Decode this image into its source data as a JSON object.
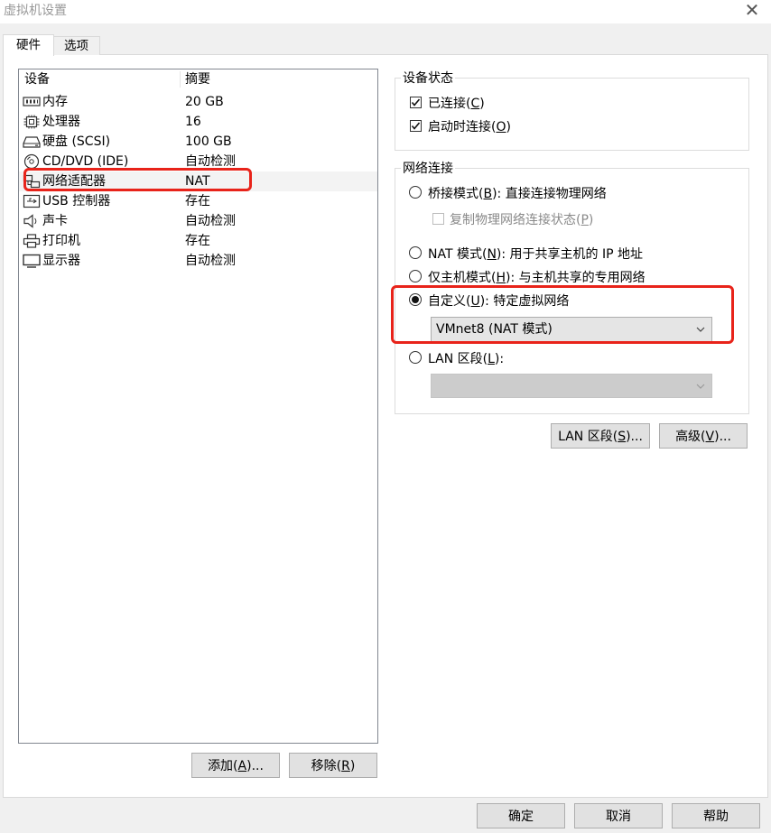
{
  "window": {
    "title": "虚拟机设置",
    "close_glyph": "✕"
  },
  "tabs": [
    {
      "label": "硬件",
      "active": true
    },
    {
      "label": "选项",
      "active": false
    }
  ],
  "device_list": {
    "headers": {
      "device": "设备",
      "summary": "摘要"
    },
    "rows": [
      {
        "icon": "memory-icon",
        "name": "内存",
        "summary": "20 GB"
      },
      {
        "icon": "processor-icon",
        "name": "处理器",
        "summary": "16"
      },
      {
        "icon": "hard-disk-icon",
        "name": "硬盘 (SCSI)",
        "summary": "100 GB"
      },
      {
        "icon": "cd-dvd-icon",
        "name": "CD/DVD (IDE)",
        "summary": "自动检测"
      },
      {
        "icon": "network-adapter-icon",
        "name": "网络适配器",
        "summary": "NAT",
        "selected": true
      },
      {
        "icon": "usb-controller-icon",
        "name": "USB 控制器",
        "summary": "存在"
      },
      {
        "icon": "sound-card-icon",
        "name": "声卡",
        "summary": "自动检测"
      },
      {
        "icon": "printer-icon",
        "name": "打印机",
        "summary": "存在"
      },
      {
        "icon": "display-icon",
        "name": "显示器",
        "summary": "自动检测"
      }
    ],
    "add": {
      "text": "添加(",
      "key": "A",
      "suffix": ")..."
    },
    "remove": {
      "text": "移除(",
      "key": "R",
      "suffix": ")"
    }
  },
  "device_status": {
    "legend": "设备状态",
    "connected": {
      "text": "已连接(",
      "key": "C",
      "suffix": ")",
      "checked": true
    },
    "connect_on_power_on": {
      "text": "启动时连接(",
      "key": "O",
      "suffix": ")",
      "checked": true
    }
  },
  "network_connection": {
    "legend": "网络连接",
    "bridged": {
      "text": "桥接模式(",
      "key": "B",
      "suffix": "): 直接连接物理网络",
      "selected": false
    },
    "replicate": {
      "text": "复制物理网络连接状态(",
      "key": "P",
      "suffix": ")",
      "checked": false,
      "disabled": true
    },
    "nat": {
      "text": "NAT 模式(",
      "key": "N",
      "suffix": "): 用于共享主机的 IP 地址",
      "selected": false
    },
    "host_only": {
      "text": "仅主机模式(",
      "key": "H",
      "suffix": "): 与主机共享的专用网络",
      "selected": false
    },
    "custom": {
      "text": "自定义(",
      "key": "U",
      "suffix": "): 特定虚拟网络",
      "selected": true
    },
    "custom_network": {
      "value": "VMnet8 (NAT 模式)"
    },
    "lan_segment": {
      "text": "LAN 区段(",
      "key": "L",
      "suffix": "):",
      "selected": false
    },
    "lan_segment_select": {
      "value": "",
      "disabled": true
    }
  },
  "buttons": {
    "lan_segments": {
      "text": "LAN 区段(",
      "key": "S",
      "suffix": ")..."
    },
    "advanced": {
      "text": "高级(",
      "key": "V",
      "suffix": ")..."
    },
    "ok": "确定",
    "cancel": "取消",
    "help": "帮助"
  },
  "colors": {
    "highlight_border": "#e8231a",
    "panel_bg": "#ffffff",
    "window_bg": "#f0f0f0"
  }
}
